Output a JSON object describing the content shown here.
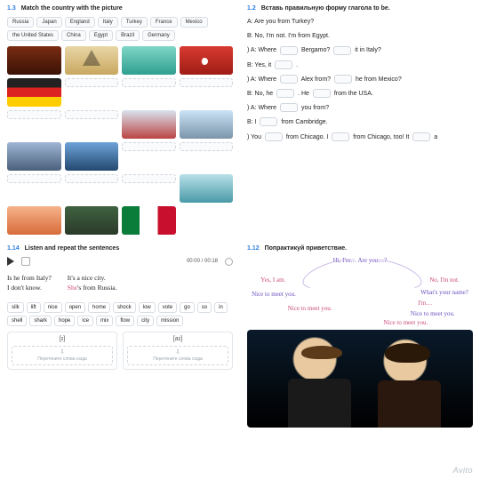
{
  "ex13": {
    "num": "1.3",
    "title": "Match the country with the picture",
    "countries": [
      "Russia",
      "Japan",
      "England",
      "Italy",
      "Turkey",
      "France",
      "Mexico",
      "the United States",
      "China",
      "Egypt",
      "Brazil",
      "Germany"
    ]
  },
  "ex14": {
    "num": "1.14",
    "title": "Listen and repeat the sentences",
    "time": "00:00 / 00:18",
    "examples": {
      "left_q": "Is he from Italy?",
      "left_a": "I don't know.",
      "right_a": "It's a nice city.",
      "right_b_pre": "She",
      "right_b_post": "'s from Russia."
    },
    "words": [
      "silk",
      "lift",
      "nice",
      "open",
      "home",
      "shock",
      "low",
      "vote",
      "go",
      "so",
      "in",
      "shell",
      "shark",
      "hope",
      "ice",
      "mix",
      "flow",
      "city",
      "mission"
    ],
    "phon": {
      "left": "[ɪ]",
      "right": "[aɪ]",
      "drop": "Перетяните слова сюда"
    }
  },
  "ex12": {
    "num": "1.2",
    "title_pre": "Вставь правильную форму глагола ",
    "title_bold": "to be.",
    "q0a": "A: Are you from Turkey?",
    "q0b": "B: No, I'm not. I'm from Egypt.",
    "q1a_1": ") A: Where",
    "q1a_2": "Bergamo?",
    "q1a_3": "it in Italy?",
    "q1b_1": "B: Yes, it",
    "q1b_2": ".",
    "q2a_1": ") A: Where",
    "q2a_2": "Alex from?",
    "q2a_3": "he from Mexico?",
    "q2b_1": "B: No, he",
    "q2b_2": ". He",
    "q2b_3": "from the USA.",
    "q3a_1": ") A: Where",
    "q3a_2": "you from?",
    "q3b_1": "B: I",
    "q3b_2": "from Cambridge.",
    "q4_1": ") You",
    "q4_2": "from Chicago. I",
    "q4_3": "from Chicago, too! It",
    "q4_4": "a"
  },
  "ex112": {
    "num": "1.12",
    "title": "Попрактикуй приветствие.",
    "top": "Hi, I'm… Are you…?",
    "l1": "Yes, I am.",
    "r1": "No, I'm not.",
    "l2": "Nice to meet you.",
    "r2": "What's your name?",
    "l3": "Nice to meet you.",
    "r3": "I'm…",
    "r4": "Nice to meet you.",
    "r5": "Nice to meet you."
  },
  "watermark": "Avito"
}
